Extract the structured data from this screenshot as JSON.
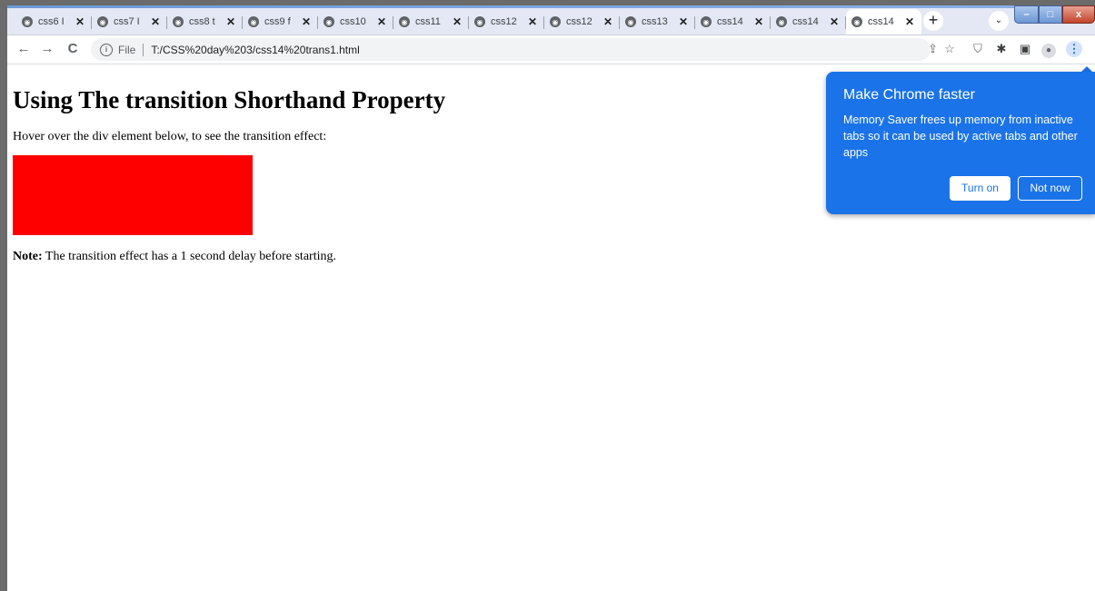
{
  "browser": {
    "tabs": [
      {
        "label": "css6 I"
      },
      {
        "label": "css7 I"
      },
      {
        "label": "css8 t"
      },
      {
        "label": "css9 f"
      },
      {
        "label": "css10"
      },
      {
        "label": "css11"
      },
      {
        "label": "css12"
      },
      {
        "label": "css12"
      },
      {
        "label": "css13"
      },
      {
        "label": "css14"
      },
      {
        "label": "css14"
      },
      {
        "label": "css14",
        "active": true
      }
    ],
    "close_glyph": "✕",
    "new_tab_glyph": "+",
    "tab_search_glyph": "⌄",
    "window_controls": {
      "minimize": "–",
      "maximize": "□",
      "close": "x"
    }
  },
  "toolbar": {
    "back": "←",
    "forward": "→",
    "reload": "C",
    "address": {
      "info_glyph": "i",
      "scheme": "File",
      "url": "T:/CSS%20day%203/css14%20trans1.html"
    },
    "icons": [
      "share-icon",
      "star-icon",
      "shield-extension-icon",
      "puzzle-icon",
      "side-panel-icon",
      "profile-icon",
      "menu-icon"
    ]
  },
  "page": {
    "heading": "Using The transition Shorthand Property",
    "intro": "Hover over the div element below, to see the transition effect:",
    "box_color": "#ff0000",
    "note_label": "Note:",
    "note_text": " The transition effect has a 1 second delay before starting."
  },
  "promo": {
    "title": "Make Chrome faster",
    "body": "Memory Saver frees up memory from inactive tabs so it can be used by active tabs and other apps",
    "turn_on": "Turn on",
    "not_now": "Not now",
    "color": "#1a73e8"
  }
}
